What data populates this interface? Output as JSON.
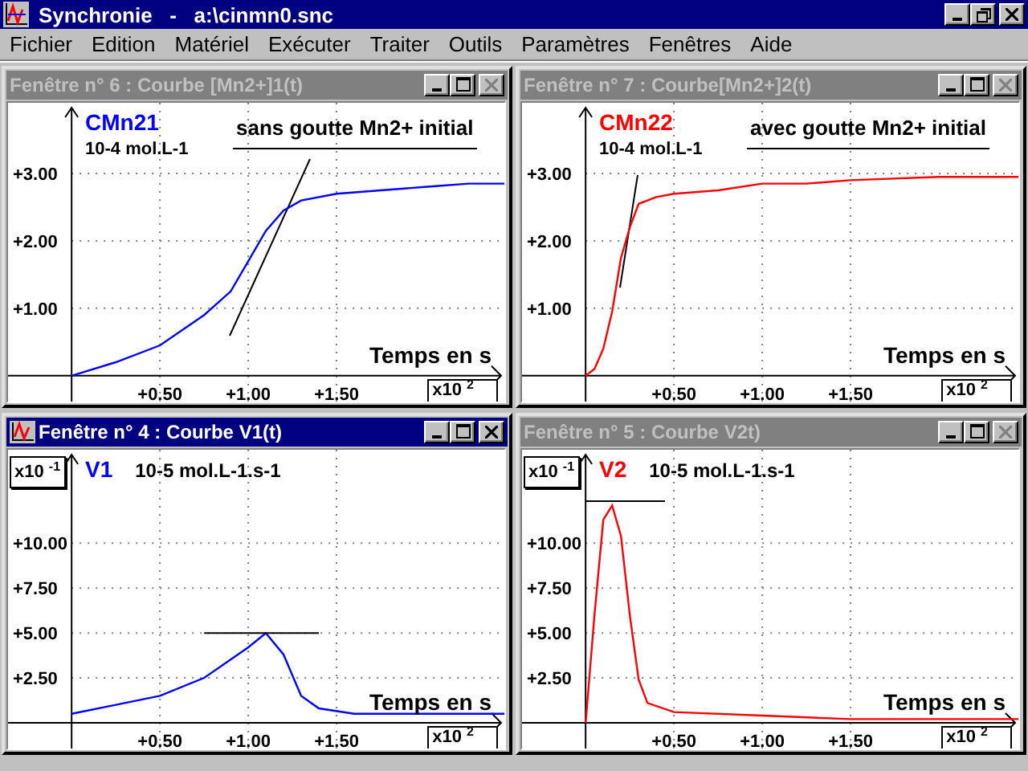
{
  "app": {
    "title": "Synchronie   -   a:\\cinmn0.snc"
  },
  "menu": [
    {
      "label": "Fichier"
    },
    {
      "label": "Edition"
    },
    {
      "label": "Matériel"
    },
    {
      "label": "Exécuter"
    },
    {
      "label": "Traiter"
    },
    {
      "label": "Outils"
    },
    {
      "label": "Paramètres"
    },
    {
      "label": "Fenêtres"
    },
    {
      "label": "Aide"
    }
  ],
  "windows": [
    {
      "title": "Fenêtre n° 6 : Courbe [Mn2+]1(t)",
      "active": false,
      "unit": "10-4 mol.L-1",
      "note": "sans goutte Mn2+ initial",
      "x_multiplier": "x10 $^{2}$",
      "chart_data": {
        "type": "line",
        "xlabel": "Temps en s",
        "grid": true,
        "x": [
          0,
          0.25,
          0.5,
          0.75,
          0.9,
          1.0,
          1.1,
          1.2,
          1.3,
          1.5,
          1.75,
          2.0,
          2.25,
          2.45
        ],
        "xlim": [
          -0.36,
          2.45
        ],
        "ylim": [
          -0.48,
          4.05
        ],
        "series": [
          {
            "name": "CMn21",
            "color": "#0000ff",
            "values": [
              0,
              0.2,
              0.45,
              0.9,
              1.25,
              1.7,
              2.15,
              2.45,
              2.6,
              2.7,
              2.75,
              2.8,
              2.85,
              2.85
            ]
          }
        ],
        "xticks": [
          {
            "value": 0.5,
            "label": "+0.50"
          },
          {
            "value": 1,
            "label": "+1.00"
          },
          {
            "value": 1.5,
            "label": "+1.50"
          }
        ],
        "yticks": [
          {
            "value": 1,
            "label": "+1.00"
          },
          {
            "value": 2,
            "label": "+2.00"
          },
          {
            "value": 3,
            "label": "+3.00"
          }
        ]
      }
    },
    {
      "title": "Fenêtre n° 7 : Courbe[Mn2+]2(t)",
      "active": false,
      "unit": "10-4 mol.L-1",
      "note": "avec goutte Mn2+ initial",
      "x_multiplier": "x10 $^{2}$",
      "chart_data": {
        "type": "line",
        "xlabel": "Temps en s",
        "grid": true,
        "x": [
          0,
          0.05,
          0.1,
          0.15,
          0.2,
          0.25,
          0.3,
          0.4,
          0.5,
          0.75,
          1.0,
          1.25,
          1.5,
          2.0,
          2.45
        ],
        "xlim": [
          -0.36,
          2.45
        ],
        "ylim": [
          -0.48,
          4.05
        ],
        "series": [
          {
            "name": "CMn22",
            "color": "#ff0000",
            "values": [
              0,
              0.1,
              0.4,
              0.95,
              1.75,
              2.2,
              2.55,
              2.65,
              2.7,
              2.75,
              2.85,
              2.85,
              2.9,
              2.95,
              2.95
            ]
          }
        ],
        "xticks": [
          {
            "value": 0.5,
            "label": "+0.50"
          },
          {
            "value": 1,
            "label": "+1.00"
          },
          {
            "value": 1.5,
            "label": "+1.50"
          }
        ],
        "yticks": [
          {
            "value": 1,
            "label": "+1.00"
          },
          {
            "value": 2,
            "label": "+2.00"
          },
          {
            "value": 3,
            "label": "+3.00"
          }
        ]
      }
    },
    {
      "title": "Fenêtre n° 4 : Courbe V1(t)",
      "active": true,
      "unit": "10-5 mol.L-1.s-1",
      "y_multiplier": "x10 $^{-1}$",
      "x_multiplier": "x10 $^{2}$",
      "chart_data": {
        "type": "line",
        "xlabel": "Temps en s",
        "grid": true,
        "x": [
          0,
          0.25,
          0.5,
          0.75,
          1.0,
          1.1,
          1.2,
          1.3,
          1.4,
          1.6,
          2.0,
          2.45
        ],
        "xlim": [
          -0.36,
          2.45
        ],
        "ylim": [
          -1.79,
          15.2
        ],
        "series": [
          {
            "name": "V1",
            "color": "#0000ff",
            "values": [
              0.5,
              1,
              1.5,
              2.5,
              4.2,
              5,
              3.8,
              1.5,
              0.8,
              0.5,
              0.5,
              0.5
            ]
          },
          {
            "color": "#000000",
            "values": [
              null,
              null,
              null,
              5,
              5,
              5,
              5,
              5,
              5,
              null,
              null,
              null
            ]
          }
        ],
        "xticks": [
          {
            "value": 0.5,
            "label": "+0.50"
          },
          {
            "value": 1,
            "label": "+1.00"
          },
          {
            "value": 1.5,
            "label": "+1.50"
          }
        ],
        "yticks": [
          {
            "value": 2.5,
            "label": "+2.50"
          },
          {
            "value": 5,
            "label": "+5.00"
          },
          {
            "value": 7.5,
            "label": "+7.50"
          },
          {
            "value": 10,
            "label": "+10.00"
          }
        ]
      }
    },
    {
      "title": "Fenêtre n° 5 : Courbe V2t)",
      "active": false,
      "unit": "10-5 mol.L-1.s-1",
      "y_multiplier": "x10 $^{-1}$",
      "x_multiplier": "x10 $^{2}$",
      "chart_data": {
        "type": "line",
        "xlabel": "Temps en s",
        "grid": true,
        "x": [
          0,
          0.05,
          0.1,
          0.15,
          0.2,
          0.25,
          0.3,
          0.35,
          0.5,
          1.0,
          1.5,
          2.0,
          2.45
        ],
        "xlim": [
          -0.36,
          2.45
        ],
        "ylim": [
          -1.79,
          15.2
        ],
        "series": [
          {
            "name": "V2",
            "color": "#ff0000",
            "values": [
              0,
              6,
              11.3,
              12.1,
              10.4,
              6,
              2.4,
              1.1,
              0.6,
              0.4,
              0.2,
              0.2,
              0.2
            ]
          }
        ],
        "xticks": [
          {
            "value": 0.5,
            "label": "+0.50"
          },
          {
            "value": 1,
            "label": "+1.00"
          },
          {
            "value": 1.5,
            "label": "+1.50"
          }
        ],
        "yticks": [
          {
            "value": 2.5,
            "label": "+2.50"
          },
          {
            "value": 5,
            "label": "+5.00"
          },
          {
            "value": 7.5,
            "label": "+7.50"
          },
          {
            "value": 10,
            "label": "+10.00"
          }
        ]
      }
    }
  ]
}
